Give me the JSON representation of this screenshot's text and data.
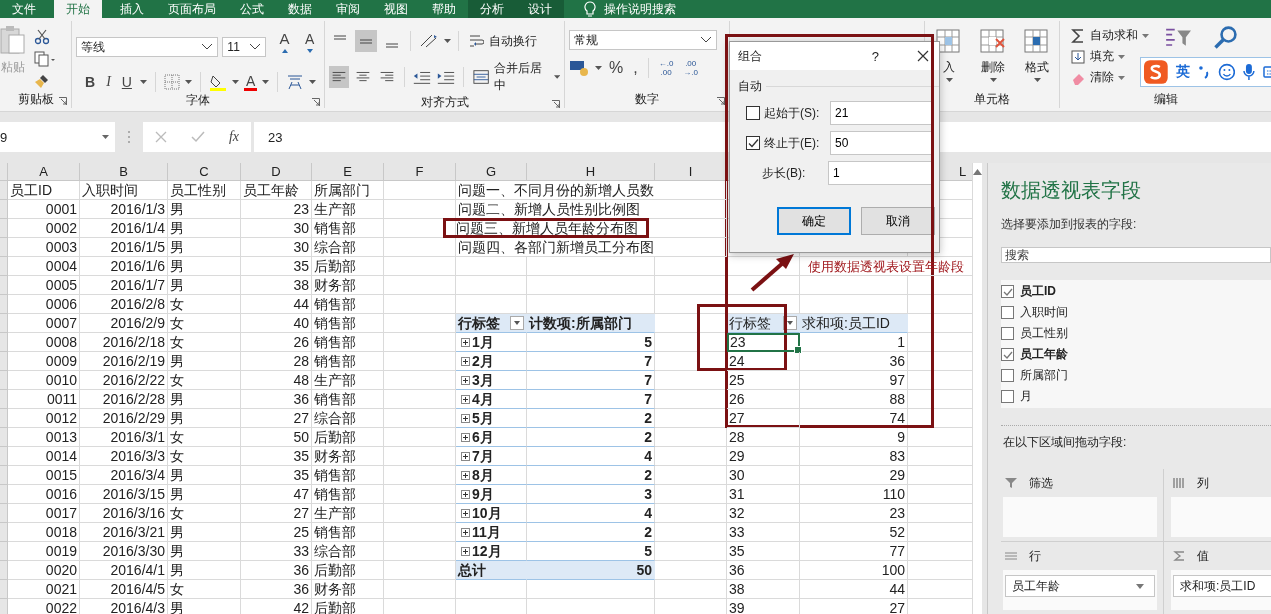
{
  "ribbon": {
    "tabs": [
      {
        "label": "文件",
        "selected": false,
        "kind": "plain"
      },
      {
        "label": "开始",
        "selected": true,
        "kind": "plain"
      },
      {
        "label": "插入",
        "selected": false,
        "kind": "plain"
      },
      {
        "label": "页面布局",
        "selected": false,
        "kind": "plain"
      },
      {
        "label": "公式",
        "selected": false,
        "kind": "plain"
      },
      {
        "label": "数据",
        "selected": false,
        "kind": "plain"
      },
      {
        "label": "审阅",
        "selected": false,
        "kind": "plain"
      },
      {
        "label": "视图",
        "selected": false,
        "kind": "plain"
      },
      {
        "label": "帮助",
        "selected": false,
        "kind": "plain"
      },
      {
        "label": "分析",
        "selected": false,
        "kind": "context"
      },
      {
        "label": "设计",
        "selected": false,
        "kind": "context"
      }
    ],
    "tell_me": "操作说明搜索",
    "clipboard": {
      "paste": "粘贴",
      "label": "剪贴板"
    },
    "font": {
      "name": "等线",
      "size": "11",
      "grow": "A",
      "shrink": "A",
      "styles": [
        "B",
        "I",
        "U"
      ],
      "color_letter": "A",
      "label": "字体"
    },
    "alignment": {
      "vertical": [
        {
          "selected": false
        },
        {
          "selected": true
        },
        {
          "selected": false
        }
      ],
      "horizontal": [
        {
          "selected": true
        },
        {
          "selected": false
        },
        {
          "selected": false
        }
      ],
      "wrap": "自动换行",
      "merge": "合并后居中",
      "label": "对齐方式"
    },
    "number": {
      "format": "常规",
      "percent": "%",
      "comma": ",",
      "decimals": [
        {
          "top": "←.0",
          "bottom": ".00"
        },
        {
          "top": ".00",
          "bottom": "→.0"
        }
      ],
      "label": "数字"
    },
    "cells": {
      "buttons": [
        "入",
        "删除",
        "格式"
      ],
      "label": "单元格"
    },
    "editing": {
      "items": [
        "自动求和",
        "填充",
        "清除"
      ],
      "label": "编辑"
    },
    "ime": {
      "mode": "英"
    }
  },
  "formula_bar": {
    "name_box": "9",
    "function_label": "fx",
    "value": "23"
  },
  "sheet": {
    "columns": [
      "A",
      "B",
      "C",
      "D",
      "E",
      "F",
      "G",
      "H",
      "I",
      "L"
    ]
  },
  "employees": {
    "header": [
      "员工ID",
      "入职时间",
      "员工性别",
      "员工年龄",
      "所属部门"
    ],
    "rows": [
      [
        "0001",
        "2016/1/3",
        "男",
        "23",
        "生产部"
      ],
      [
        "0002",
        "2016/1/4",
        "男",
        "30",
        "销售部"
      ],
      [
        "0003",
        "2016/1/5",
        "男",
        "30",
        "综合部"
      ],
      [
        "0004",
        "2016/1/6",
        "男",
        "35",
        "后勤部"
      ],
      [
        "0005",
        "2016/1/7",
        "男",
        "38",
        "财务部"
      ],
      [
        "0006",
        "2016/2/8",
        "女",
        "44",
        "销售部"
      ],
      [
        "0007",
        "2016/2/9",
        "女",
        "40",
        "销售部"
      ],
      [
        "0008",
        "2016/2/18",
        "女",
        "26",
        "销售部"
      ],
      [
        "0009",
        "2016/2/19",
        "男",
        "28",
        "销售部"
      ],
      [
        "0010",
        "2016/2/22",
        "女",
        "48",
        "生产部"
      ],
      [
        "0011",
        "2016/2/28",
        "男",
        "36",
        "销售部"
      ],
      [
        "0012",
        "2016/2/29",
        "男",
        "27",
        "综合部"
      ],
      [
        "0013",
        "2016/3/1",
        "女",
        "50",
        "后勤部"
      ],
      [
        "0014",
        "2016/3/3",
        "女",
        "35",
        "财务部"
      ],
      [
        "0015",
        "2016/3/4",
        "男",
        "35",
        "销售部"
      ],
      [
        "0016",
        "2016/3/15",
        "男",
        "47",
        "销售部"
      ],
      [
        "0017",
        "2016/3/16",
        "女",
        "27",
        "生产部"
      ],
      [
        "0018",
        "2016/3/21",
        "男",
        "25",
        "销售部"
      ],
      [
        "0019",
        "2016/3/30",
        "男",
        "33",
        "综合部"
      ],
      [
        "0020",
        "2016/4/1",
        "男",
        "36",
        "后勤部"
      ],
      [
        "0021",
        "2016/4/5",
        "女",
        "36",
        "财务部"
      ],
      [
        "0022",
        "2016/4/3",
        "男",
        "42",
        "后勤部"
      ]
    ]
  },
  "questions": [
    {
      "text": "问题一、不同月份的新增人员数",
      "highlighted": false
    },
    {
      "text": "问题二、新增人员性别比例图",
      "highlighted": false
    },
    {
      "text": "问题三、新增人员年龄分布图",
      "highlighted": true
    },
    {
      "text": "问题四、各部门新增员工分布图",
      "highlighted": false
    }
  ],
  "annotation": "使用数据透视表设置年龄段",
  "pivot_month": {
    "row_label": "行标签",
    "value_label": "计数项:所属部门",
    "rows": [
      {
        "label": "1月",
        "value": "5"
      },
      {
        "label": "2月",
        "value": "7"
      },
      {
        "label": "3月",
        "value": "7"
      },
      {
        "label": "4月",
        "value": "7"
      },
      {
        "label": "5月",
        "value": "2"
      },
      {
        "label": "6月",
        "value": "2"
      },
      {
        "label": "7月",
        "value": "4"
      },
      {
        "label": "8月",
        "value": "2"
      },
      {
        "label": "9月",
        "value": "3"
      },
      {
        "label": "10月",
        "value": "4"
      },
      {
        "label": "11月",
        "value": "2"
      },
      {
        "label": "12月",
        "value": "5"
      }
    ],
    "total": {
      "label": "总计",
      "value": "50"
    }
  },
  "pivot_age": {
    "row_label": "行标签",
    "value_label": "求和项:员工ID",
    "rows": [
      {
        "label": "23",
        "value": "1",
        "selected": true
      },
      {
        "label": "24",
        "value": "36",
        "selected": false
      },
      {
        "label": "25",
        "value": "97",
        "selected": false
      },
      {
        "label": "26",
        "value": "88",
        "selected": false
      },
      {
        "label": "27",
        "value": "74",
        "selected": false
      },
      {
        "label": "28",
        "value": "9",
        "selected": false
      },
      {
        "label": "29",
        "value": "83",
        "selected": false
      },
      {
        "label": "30",
        "value": "29",
        "selected": false
      },
      {
        "label": "31",
        "value": "110",
        "selected": false
      },
      {
        "label": "32",
        "value": "23",
        "selected": false
      },
      {
        "label": "33",
        "value": "52",
        "selected": false
      },
      {
        "label": "35",
        "value": "77",
        "selected": false
      },
      {
        "label": "36",
        "value": "100",
        "selected": false
      },
      {
        "label": "38",
        "value": "44",
        "selected": false
      },
      {
        "label": "39",
        "value": "27",
        "selected": false
      }
    ]
  },
  "dialog": {
    "title": "组合",
    "help": "?",
    "section": "自动",
    "fields": [
      {
        "kind": "checkbox",
        "label": "起始于(S):",
        "value": "21",
        "checked": false
      },
      {
        "kind": "checkbox",
        "label": "终止于(E):",
        "value": "50",
        "checked": true
      },
      {
        "kind": "plain",
        "label": "步长(B):",
        "value": "1"
      }
    ],
    "buttons": [
      {
        "label": "确定",
        "default": true
      },
      {
        "label": "取消",
        "default": false
      }
    ]
  },
  "field_list": {
    "title": "数据透视表字段",
    "subtitle": "选择要添加到报表的字段:",
    "search_placeholder": "搜索",
    "fields": [
      {
        "label": "员工ID",
        "checked": true
      },
      {
        "label": "入职时间",
        "checked": false
      },
      {
        "label": "员工性别",
        "checked": false
      },
      {
        "label": "员工年龄",
        "checked": true
      },
      {
        "label": "所属部门",
        "checked": false
      },
      {
        "label": "月",
        "checked": false
      }
    ],
    "areas_label": "在以下区域间拖动字段:",
    "areas": [
      {
        "kind": "filter",
        "label": "筛选"
      },
      {
        "kind": "columns",
        "label": "列"
      },
      {
        "kind": "rows",
        "label": "行",
        "item": "员工年龄"
      },
      {
        "kind": "values",
        "label": "值",
        "item": "求和项:员工ID"
      }
    ]
  }
}
